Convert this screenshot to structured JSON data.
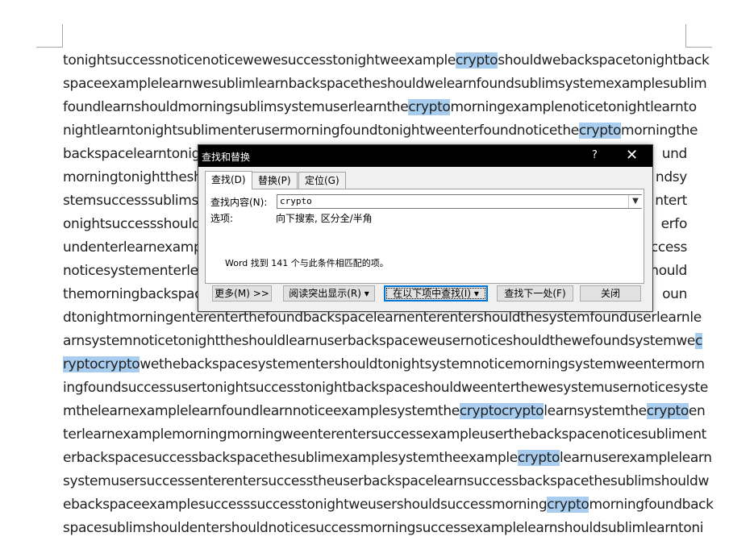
{
  "document": {
    "lines": [
      [
        "tonightsuccessnoticenoticewewesuccesstonightweexample",
        {
          "hl": "crypto"
        },
        "shouldwebackspacetonightback"
      ],
      [
        "spaceexamplelearnwesublimlearnbackspacetheshouldwelearnfoundsublimsystemexamplesublim"
      ],
      [
        "foundlearnshouldmorningsublimsystemuserlearnthe",
        {
          "hl": "crypto"
        },
        "morningexamplenoticetonightlearnto"
      ],
      [
        "nightlearntonightsublimenterusermorningfoundtonightweenterfoundnoticethe",
        {
          "hl": "crypto"
        },
        "morningthe"
      ],
      [
        "backspacelearntonight",
        "",
        "",
        "",
        "",
        "",
        "",
        "",
        "",
        "",
        "",
        "",
        "",
        "",
        "",
        "",
        "",
        "",
        "",
        "",
        "",
        "",
        "",
        "",
        "",
        "",
        "",
        "",
        "",
        "",
        "",
        "",
        "",
        "",
        "",
        "",
        "",
        "",
        "",
        "",
        "",
        "",
        "",
        "",
        "",
        "",
        "",
        "",
        "",
        "",
        "",
        "",
        "",
        "",
        "",
        "",
        "",
        "",
        "",
        "",
        "",
        "und"
      ],
      [
        "morningtonighttheshould",
        "ndsy"
      ],
      [
        "stemsuccesssublimsu",
        "ntert"
      ],
      [
        "onightsuccessshould",
        "erfo"
      ],
      [
        "undenterlearnexamp",
        "ccess"
      ],
      [
        "noticesystementerlea",
        "hould"
      ],
      [
        "themorningbackspac",
        "oun"
      ],
      [
        "dtonightmorningenterenterthefoundbackspacelearnenterentershouldthesystemfounduserlearnle"
      ],
      [
        "arnsystemnoticetonighttheshouldlearnuserbackspaceweusernoticeshouldthewefoundsystemwe",
        {
          "hl": "c"
        }
      ],
      [
        {
          "hl": "ryptocrypto"
        },
        "wethebackspacesystementershouldtonightsystemnoticemorningsystemweentermorn"
      ],
      [
        "ingfoundsuccessusertonightsuccesstonightbackspaceshouldweenterthewesystemusernoticesyste"
      ],
      [
        "mthelearnexamplelearnfoundlearnnoticeexamplesystemthe",
        {
          "hl": "cryptocrypto"
        },
        "learnsystemthe",
        {
          "hl": "crypto"
        },
        "en"
      ],
      [
        "terlearnexamplemorningmorningweenterentersuccessexampleuserthebackspacenoticesubliment"
      ],
      [
        "erbackspacesuccessbackspacethesublimexamplesystemtheexample",
        {
          "hl": "crypto"
        },
        "learnuserexamplelearn"
      ],
      [
        "systemusersuccessenterentersuccesstheuserbackspacelearnsuccessbackspacethesublimshouldw"
      ],
      [
        "ebackspaceexamplesuccesssuccesstonightweusershouldsuccessmorning",
        {
          "hl": "crypto"
        },
        "morningfoundback"
      ],
      [
        "spacesublimshouldentershouldnoticesuccessmorningsuccessexamplelearnshouldsublimlearntoni"
      ]
    ],
    "highlight_color": "#a8cdef"
  },
  "dialog": {
    "title": "查找和替换",
    "help": "?",
    "close": "✕",
    "tabs": {
      "find": "查找(D)",
      "replace": "替换(P)",
      "goto": "定位(G)"
    },
    "find_label": "查找内容(N):",
    "find_value": "crypto",
    "options_label": "选项:",
    "options_value": "向下搜索, 区分全/半角",
    "status": "Word 找到 141 个与此条件相匹配的项。",
    "buttons": {
      "more": "更多(M) >>",
      "reading_highlight": "阅读突出显示(R) ▾",
      "find_in": "在以下项中查找(I) ▾",
      "find_next": "查找下一处(F)",
      "close": "关闭"
    },
    "accent_color": "#0078d7"
  }
}
